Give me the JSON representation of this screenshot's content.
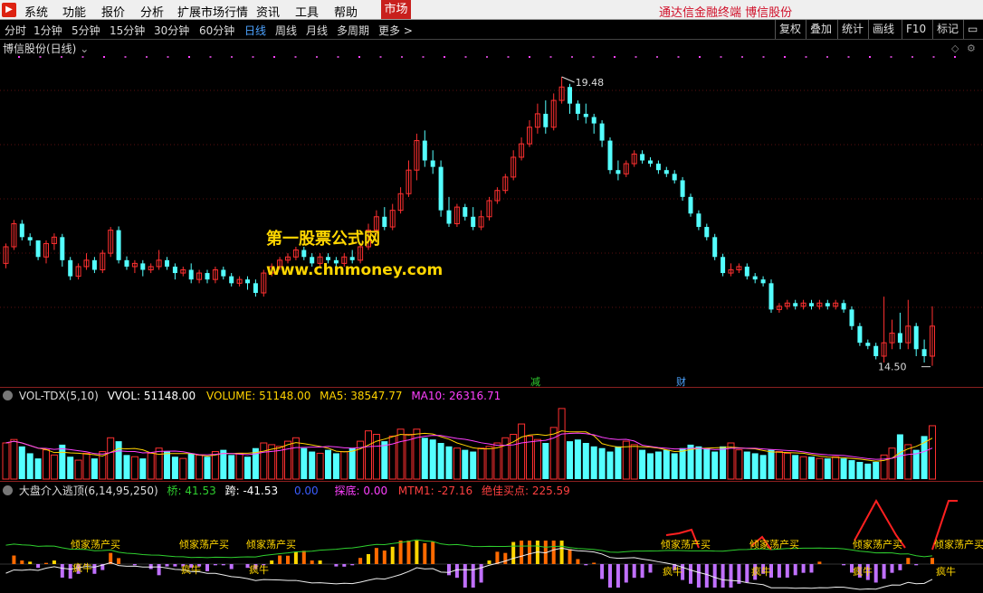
{
  "menubar": {
    "items": [
      "系统",
      "功能",
      "报价",
      "分析",
      "扩展市场行情",
      "资讯",
      "工具",
      "帮助"
    ],
    "market_tab": "市场",
    "title": "通达信金融终端  博信股份"
  },
  "toolbar": {
    "periods": [
      "分时",
      "1分钟",
      "5分钟",
      "15分钟",
      "30分钟",
      "60分钟",
      "日线",
      "周线",
      "月线",
      "多周期",
      "更多 >"
    ],
    "active_period": "日线",
    "right_buttons": [
      "复权",
      "叠加",
      "统计",
      "画线",
      "F10",
      "标记"
    ]
  },
  "price_pane": {
    "title": "博信股份(日线)",
    "high_label": "19.48",
    "low_label": "14.50",
    "watermark_line1": "第一股票公式网",
    "watermark_line2": "www.chnmoney.com",
    "event_markers": [
      "减",
      "财"
    ],
    "colors": {
      "up": "#ff3030",
      "down": "#54ffff",
      "text": "#ffffff"
    }
  },
  "volume_pane": {
    "indicator": "VOL-TDX(5,10)",
    "vvol": "VVOL: 51148.00",
    "volume": "VOLUME: 51148.00",
    "ma5": "MA5: 38547.77",
    "ma10": "MA10: 26316.71"
  },
  "indicator_pane": {
    "indicator": "大盘介入逃顶(6,14,95,250)",
    "qiao": "桥: 41.53",
    "kua": "跨: -41.53",
    "val3": "0.00",
    "tandi": "探底: 0.00",
    "mtm1": "MTM1: -27.16",
    "best_buy": "绝佳买点: 225.59",
    "label_buy": "倾家荡产买",
    "label_bull": "疯牛"
  },
  "chart_data": {
    "type": "candlestick",
    "ylim": [
      14.0,
      19.8
    ],
    "candles": [
      [
        16.0,
        16.31,
        15.91,
        16.37
      ],
      [
        16.31,
        16.74,
        16.25,
        16.81
      ],
      [
        16.74,
        16.49,
        16.43,
        16.81
      ],
      [
        16.49,
        16.43,
        16.33,
        16.56
      ],
      [
        16.43,
        16.12,
        16.06,
        16.18
      ],
      [
        16.12,
        16.37,
        16.0,
        16.43
      ],
      [
        16.37,
        16.49,
        16.25,
        16.56
      ],
      [
        16.49,
        16.06,
        15.94,
        16.55
      ],
      [
        16.06,
        15.76,
        15.69,
        16.12
      ],
      [
        15.76,
        15.94,
        15.7,
        16.0
      ],
      [
        15.94,
        16.06,
        15.88,
        16.19
      ],
      [
        16.06,
        15.88,
        15.82,
        16.12
      ],
      [
        15.88,
        16.19,
        15.82,
        16.25
      ],
      [
        16.19,
        16.62,
        16.12,
        16.68
      ],
      [
        16.62,
        16.06,
        16.0,
        16.69
      ],
      [
        16.06,
        15.94,
        15.88,
        16.13
      ],
      [
        15.94,
        16.0,
        15.82,
        16.06
      ],
      [
        16.0,
        15.88,
        15.76,
        16.06
      ],
      [
        15.88,
        15.94,
        15.82,
        16.0
      ],
      [
        15.94,
        16.06,
        15.88,
        16.25
      ],
      [
        16.06,
        15.94,
        15.88,
        16.12
      ],
      [
        15.94,
        15.82,
        15.7,
        16.0
      ],
      [
        15.82,
        15.88,
        15.76,
        15.94
      ],
      [
        15.88,
        15.7,
        15.63,
        16.0
      ],
      [
        15.7,
        15.82,
        15.63,
        15.88
      ],
      [
        15.82,
        15.7,
        15.63,
        15.88
      ],
      [
        15.7,
        15.88,
        15.63,
        15.94
      ],
      [
        15.88,
        15.76,
        15.7,
        15.94
      ],
      [
        15.76,
        15.63,
        15.57,
        15.82
      ],
      [
        15.63,
        15.7,
        15.57,
        15.76
      ],
      [
        15.7,
        15.63,
        15.51,
        15.76
      ],
      [
        15.63,
        15.45,
        15.38,
        15.7
      ],
      [
        15.45,
        15.82,
        15.38,
        15.88
      ],
      [
        15.82,
        15.94,
        15.76,
        16.0
      ],
      [
        15.94,
        16.06,
        15.88,
        16.12
      ],
      [
        16.06,
        16.12,
        16.0,
        16.19
      ],
      [
        16.12,
        16.25,
        16.06,
        16.31
      ],
      [
        16.25,
        16.12,
        16.06,
        16.31
      ],
      [
        16.12,
        16.0,
        15.94,
        16.19
      ],
      [
        16.0,
        16.12,
        15.94,
        16.19
      ],
      [
        16.12,
        16.06,
        16.0,
        16.19
      ],
      [
        16.06,
        16.0,
        15.94,
        16.12
      ],
      [
        16.0,
        16.12,
        15.94,
        16.19
      ],
      [
        16.12,
        16.06,
        16.0,
        16.25
      ],
      [
        16.06,
        16.31,
        16.0,
        16.37
      ],
      [
        16.31,
        16.62,
        16.25,
        16.74
      ],
      [
        16.62,
        16.87,
        16.55,
        16.99
      ],
      [
        16.87,
        16.68,
        16.62,
        17.05
      ],
      [
        16.68,
        16.99,
        16.62,
        17.11
      ],
      [
        16.99,
        17.3,
        16.93,
        17.42
      ],
      [
        17.3,
        17.74,
        17.24,
        17.92
      ],
      [
        17.74,
        18.29,
        17.55,
        18.42
      ],
      [
        18.29,
        17.92,
        17.8,
        18.48
      ],
      [
        17.92,
        17.8,
        17.67,
        18.11
      ],
      [
        17.8,
        16.99,
        16.87,
        17.92
      ],
      [
        16.99,
        16.74,
        16.68,
        17.24
      ],
      [
        16.74,
        17.05,
        16.68,
        17.11
      ],
      [
        17.05,
        16.87,
        16.8,
        17.11
      ],
      [
        16.87,
        16.68,
        16.62,
        17.05
      ],
      [
        16.68,
        16.87,
        16.62,
        16.99
      ],
      [
        16.87,
        17.17,
        16.8,
        17.24
      ],
      [
        17.17,
        17.36,
        17.11,
        17.42
      ],
      [
        17.36,
        17.61,
        17.3,
        17.67
      ],
      [
        17.61,
        17.98,
        17.55,
        18.11
      ],
      [
        17.98,
        18.23,
        17.92,
        18.35
      ],
      [
        18.23,
        18.54,
        18.17,
        18.67
      ],
      [
        18.54,
        18.79,
        18.42,
        18.98
      ],
      [
        18.79,
        18.54,
        18.42,
        19.04
      ],
      [
        18.54,
        19.04,
        18.48,
        19.17
      ],
      [
        19.04,
        19.29,
        18.98,
        19.48
      ],
      [
        19.29,
        18.98,
        18.79,
        19.35
      ],
      [
        18.98,
        18.79,
        18.67,
        19.04
      ],
      [
        18.79,
        18.73,
        18.61,
        18.98
      ],
      [
        18.73,
        18.61,
        18.42,
        18.79
      ],
      [
        18.61,
        18.29,
        18.17,
        18.67
      ],
      [
        18.29,
        17.74,
        17.67,
        18.35
      ],
      [
        17.74,
        17.67,
        17.55,
        17.92
      ],
      [
        17.67,
        17.86,
        17.61,
        17.92
      ],
      [
        17.86,
        18.04,
        17.8,
        18.11
      ],
      [
        18.04,
        17.92,
        17.86,
        18.11
      ],
      [
        17.92,
        17.86,
        17.8,
        17.98
      ],
      [
        17.86,
        17.74,
        17.67,
        17.92
      ],
      [
        17.74,
        17.67,
        17.61,
        17.8
      ],
      [
        17.67,
        17.55,
        17.49,
        17.74
      ],
      [
        17.55,
        17.24,
        17.17,
        17.61
      ],
      [
        17.24,
        16.93,
        16.87,
        17.3
      ],
      [
        16.93,
        16.68,
        16.62,
        16.99
      ],
      [
        16.68,
        16.49,
        16.43,
        16.74
      ],
      [
        16.49,
        16.12,
        16.06,
        16.55
      ],
      [
        16.12,
        15.82,
        15.76,
        16.18
      ],
      [
        15.82,
        15.88,
        15.76,
        16.0
      ],
      [
        15.88,
        15.94,
        15.82,
        16.0
      ],
      [
        15.94,
        15.76,
        15.7,
        16.0
      ],
      [
        15.76,
        15.7,
        15.63,
        15.82
      ],
      [
        15.7,
        15.63,
        15.57,
        15.76
      ],
      [
        15.63,
        15.14,
        15.08,
        15.7
      ],
      [
        15.14,
        15.2,
        15.08,
        15.26
      ],
      [
        15.2,
        15.26,
        15.14,
        15.32
      ],
      [
        15.26,
        15.2,
        15.14,
        15.32
      ],
      [
        15.2,
        15.26,
        15.14,
        15.32
      ],
      [
        15.26,
        15.2,
        15.14,
        15.32
      ],
      [
        15.2,
        15.26,
        15.14,
        15.32
      ],
      [
        15.26,
        15.2,
        15.14,
        15.32
      ],
      [
        15.2,
        15.26,
        15.14,
        15.32
      ],
      [
        15.26,
        15.14,
        15.08,
        15.32
      ],
      [
        15.14,
        14.83,
        14.76,
        15.2
      ],
      [
        14.83,
        14.52,
        14.46,
        14.89
      ],
      [
        14.52,
        14.46,
        14.4,
        14.58
      ],
      [
        14.46,
        14.27,
        14.21,
        14.52
      ],
      [
        14.27,
        14.52,
        14.15,
        15.38
      ],
      [
        14.52,
        14.7,
        14.4,
        14.95
      ],
      [
        14.7,
        14.52,
        14.4,
        15.08
      ],
      [
        14.52,
        14.83,
        14.4,
        15.32
      ],
      [
        14.83,
        14.4,
        14.27,
        14.89
      ],
      [
        14.4,
        14.27,
        14.15,
        14.58
      ],
      [
        14.27,
        14.83,
        14.09,
        15.2
      ]
    ],
    "volume": [
      2.1,
      2.3,
      1.9,
      1.5,
      1.2,
      1.7,
      1.4,
      2.0,
      1.3,
      1.1,
      1.5,
      1.2,
      1.6,
      2.4,
      2.2,
      1.4,
      1.3,
      1.2,
      1.5,
      1.8,
      1.6,
      1.3,
      1.2,
      1.5,
      1.4,
      1.3,
      1.6,
      1.7,
      1.4,
      1.5,
      1.3,
      1.8,
      2.1,
      2.0,
      1.9,
      2.2,
      2.4,
      1.8,
      1.6,
      1.5,
      1.7,
      1.5,
      1.6,
      1.8,
      2.2,
      2.8,
      2.6,
      2.2,
      2.5,
      2.9,
      2.6,
      2.9,
      2.4,
      2.3,
      2.1,
      1.9,
      1.8,
      1.7,
      1.6,
      1.8,
      1.9,
      2.1,
      2.4,
      2.6,
      3.2,
      2.5,
      2.3,
      2.1,
      3.0,
      4.1,
      2.2,
      2.3,
      2.1,
      1.9,
      1.8,
      1.6,
      1.9,
      2.2,
      2.0,
      1.7,
      1.5,
      1.6,
      1.7,
      1.5,
      1.8,
      2.0,
      1.9,
      1.8,
      1.6,
      1.9,
      2.1,
      1.7,
      1.6,
      1.5,
      1.4,
      1.7,
      1.6,
      1.5,
      1.4,
      1.3,
      1.3,
      1.2,
      1.2,
      1.3,
      1.2,
      1.1,
      1.0,
      0.9,
      1.0,
      1.4,
      1.8,
      2.6,
      2.0,
      1.7,
      2.5,
      3.1
    ],
    "volume_ylim": [
      0,
      4.2
    ]
  }
}
